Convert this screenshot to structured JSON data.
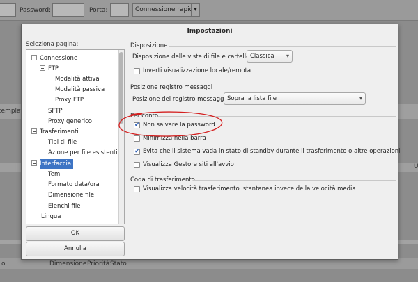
{
  "background": {
    "password_label": "Password:",
    "port_label": "Porta:",
    "quickconnect_label": "Connessione rapida",
    "dropdown_arrow": "▾",
    "left_partial_text": "templat",
    "status_columns": [
      "Dimensione",
      "Priorità",
      "Stato"
    ],
    "status_partial_left": "o",
    "right_partial_text": "U"
  },
  "dialog": {
    "title": "Impostazioni",
    "page_select_label": "Seleziona pagina:",
    "ok_label": "OK",
    "cancel_label": "Annulla",
    "tree": [
      {
        "label": "Connessione",
        "level": 0,
        "expander": true
      },
      {
        "label": "FTP",
        "level": 1,
        "expander": true
      },
      {
        "label": "Modalità attiva",
        "level": 2
      },
      {
        "label": "Modalità passiva",
        "level": 2
      },
      {
        "label": "Proxy FTP",
        "level": 2
      },
      {
        "label": "SFTP",
        "level": 1
      },
      {
        "label": "Proxy generico",
        "level": 1
      },
      {
        "label": "Trasferimenti",
        "level": 0,
        "expander": true
      },
      {
        "label": "Tipi di file",
        "level": 1
      },
      {
        "label": "Azione per file esistenti",
        "level": 1
      },
      {
        "label": "Interfaccia",
        "level": 0,
        "expander": true,
        "selected": true
      },
      {
        "label": "Temi",
        "level": 1
      },
      {
        "label": "Formato data/ora",
        "level": 1
      },
      {
        "label": "Dimensione file",
        "level": 1
      },
      {
        "label": "Elenchi file",
        "level": 1
      },
      {
        "label": "Lingua",
        "level": 0
      }
    ],
    "disposizione": {
      "title": "Disposizione",
      "layout_label": "Disposizione delle viste di file e cartelle:",
      "layout_value": "Classica",
      "invert_label": "Inverti visualizzazione locale/remota",
      "invert_checked": false
    },
    "log_position": {
      "title": "Posizione registro messaggi",
      "label": "Posizione del registro messaggi:",
      "value": "Sopra la lista file"
    },
    "per_conto": {
      "title": "Per conto",
      "items": [
        {
          "label": "Non salvare la password",
          "checked": true
        },
        {
          "label": "Minimizza nella barra",
          "checked": false
        },
        {
          "label": "Evita che il sistema vada in stato di standby durante il trasferimento o altre operazioni",
          "checked": true
        },
        {
          "label": "Visualizza Gestore siti all'avvio",
          "checked": false
        }
      ]
    },
    "transfer_queue": {
      "title": "Coda di trasferimento",
      "speed_label": "Visualizza velocità trasferimento istantanea invece della velocità media",
      "speed_checked": false
    }
  },
  "colors": {
    "selection": "#3d74c4",
    "annotation_ellipse": "#d42020",
    "check_mark": "#2c5fb4"
  }
}
